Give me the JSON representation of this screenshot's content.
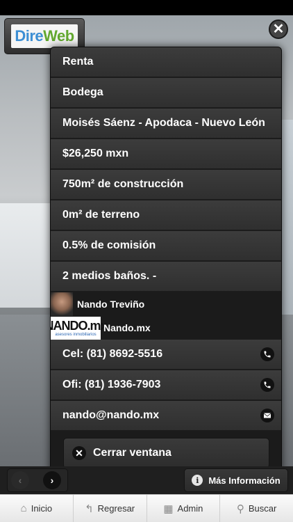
{
  "logo": {
    "part1": "Dire",
    "part2": "Web"
  },
  "listing": {
    "rows": [
      "Renta",
      "Bodega",
      "Moisés Sáenz - Apodaca - Nuevo León",
      "$26,250 mxn",
      "750m² de construcción",
      "0m² de terreno",
      "0.5% de comisión",
      "2 medios baños. -"
    ]
  },
  "agent": {
    "name": "Nando Treviño",
    "agency": "Nando.mx",
    "agency_logo_text": "NANDO.mx",
    "agency_logo_tagline": "asesores inmobiliarios"
  },
  "contact": {
    "cel": "Cel: (81) 8692-5516",
    "ofi": "Ofi: (81) 1936-7903",
    "email": "nando@nando.mx"
  },
  "close_button": "Cerrar ventana",
  "more_info": "Más Información",
  "nav": {
    "home": "Inicio",
    "back": "Regresar",
    "admin": "Admin",
    "search": "Buscar"
  },
  "icons": {
    "close": "close-icon",
    "phone": "phone-icon",
    "mail": "mail-icon",
    "info": "info-icon",
    "home": "home-icon",
    "back": "back-icon",
    "grid": "grid-icon",
    "search": "search-icon"
  }
}
